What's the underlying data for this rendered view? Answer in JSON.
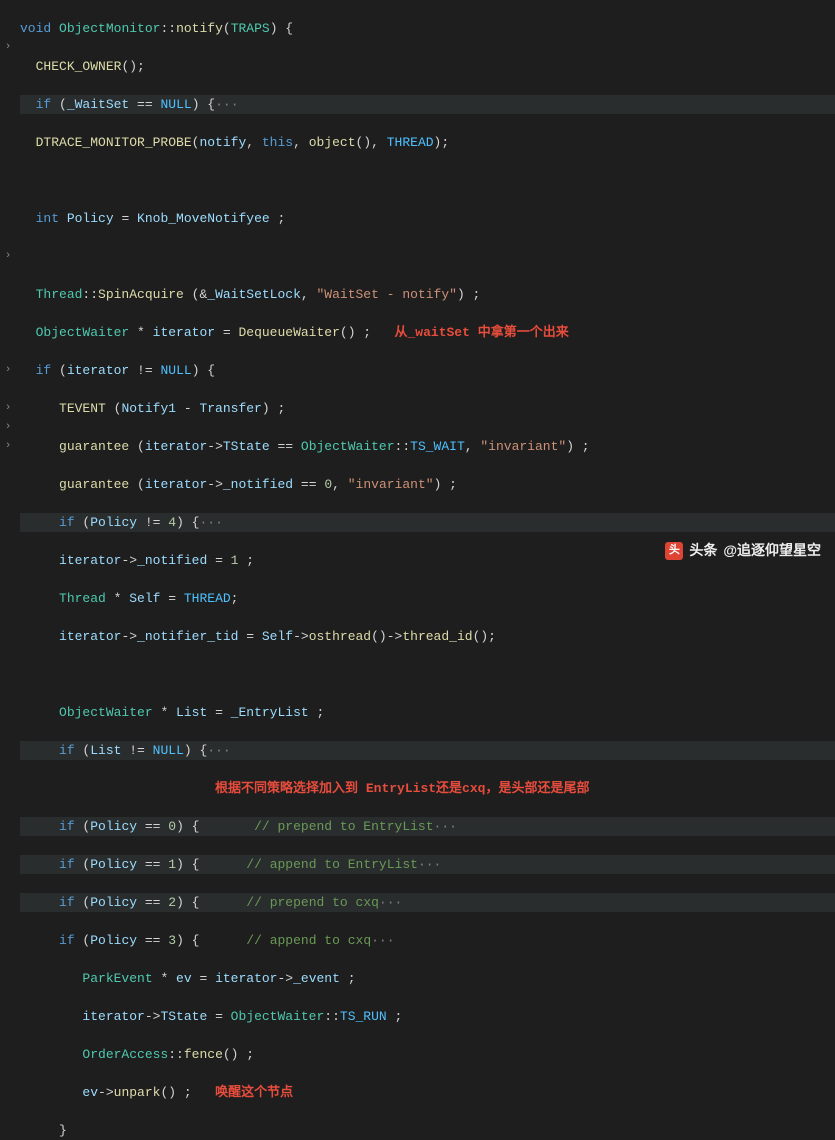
{
  "code": {
    "tokens": {
      "void": "void",
      "class": "ObjectMonitor",
      "notify": "notify",
      "traps": "TRAPS",
      "checkOwner": "CHECK_OWNER",
      "if": "if",
      "waitset": "_WaitSet",
      "null": "NULL",
      "dtrace": "DTRACE_MONITOR_PROBE",
      "this": "this",
      "object": "object",
      "thread": "THREAD",
      "int": "int",
      "policy": "Policy",
      "knob": "Knob_MoveNotifyee",
      "threadCls": "Thread",
      "spinAcquire": "SpinAcquire",
      "waitSetLock": "_WaitSetLock",
      "str1": "\"WaitSet - notify\"",
      "objectWaiter": "ObjectWaiter",
      "iterator": "iterator",
      "dequeueWaiter": "DequeueWaiter",
      "tevent": "TEVENT",
      "notify1": "Notify1",
      "transfer": "Transfer",
      "guarantee": "guarantee",
      "tstate": "TState",
      "tsWait": "TS_WAIT",
      "invariant": "\"invariant\"",
      "notified": "_notified",
      "self": "Self",
      "notifierTid": "_notifier_tid",
      "osthread": "osthread",
      "threadId": "thread_id",
      "list": "List",
      "entryList": "_EntryList",
      "comment1": "// prepend to EntryList",
      "comment2": "// append to EntryList",
      "comment3": "// prepend to cxq",
      "comment4": "// append to cxq",
      "parkEvent": "ParkEvent",
      "ev": "ev",
      "event": "_event",
      "tsRun": "TS_RUN",
      "orderAccess": "OrderAccess",
      "fence": "fence",
      "unpark": "unpark"
    },
    "annotations": {
      "a1": "从_waitSet 中拿第一个出来",
      "a2": "根据不同策略选择加入到 EntryList还是cxq，是头部还是尾部",
      "a3": "唤醒这个节点"
    }
  },
  "gutter": {
    "foldMarker": "›"
  },
  "watermark": {
    "prefix": "头条",
    "handle": "@追逐仰望星空",
    "icon": "头"
  }
}
